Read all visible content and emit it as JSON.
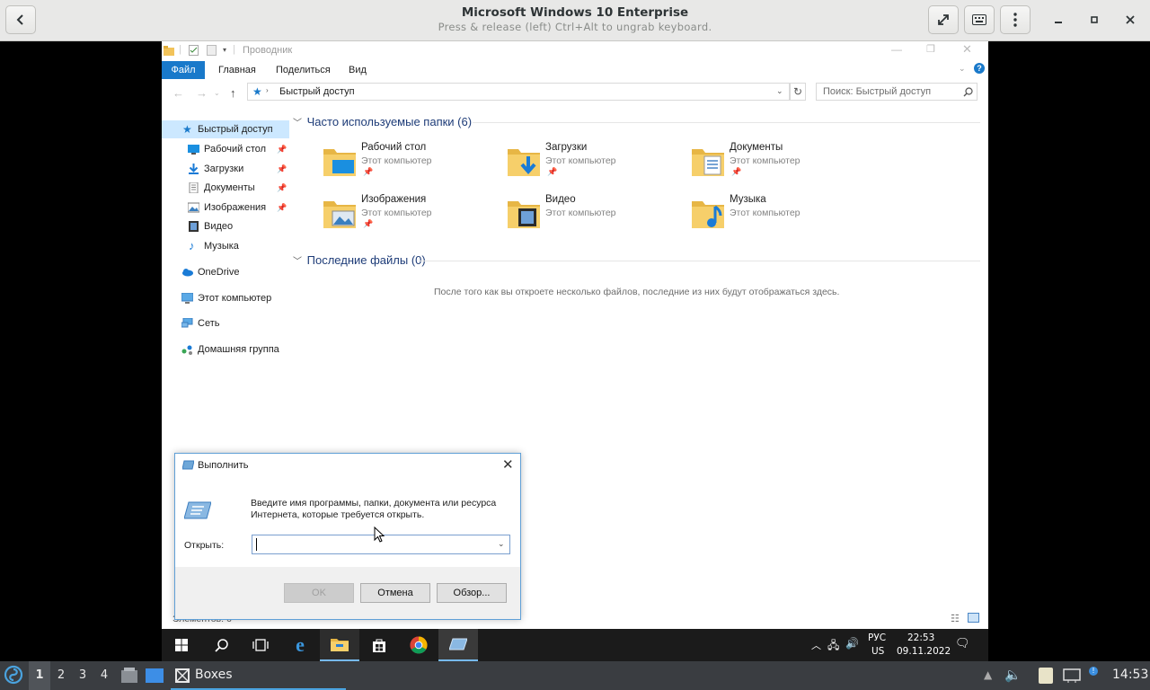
{
  "boxes": {
    "title": "Microsoft Windows 10 Enterprise",
    "subtitle": "Press & release (left) Ctrl+Alt to ungrab keyboard."
  },
  "explorer": {
    "window_title": "Проводник",
    "ribbon_tabs": [
      "Файл",
      "Главная",
      "Поделиться",
      "Вид"
    ],
    "address": "Быстрый доступ",
    "search_placeholder": "Поиск: Быстрый доступ",
    "sidebar": [
      {
        "label": "Быстрый доступ",
        "icon": "star-icon",
        "pinned": false
      },
      {
        "label": "Рабочий стол",
        "icon": "desktop-icon",
        "pinned": true
      },
      {
        "label": "Загрузки",
        "icon": "downloads-icon",
        "pinned": true
      },
      {
        "label": "Документы",
        "icon": "documents-icon",
        "pinned": true
      },
      {
        "label": "Изображения",
        "icon": "pictures-icon",
        "pinned": true
      },
      {
        "label": "Видео",
        "icon": "video-icon",
        "pinned": false
      },
      {
        "label": "Музыка",
        "icon": "music-icon",
        "pinned": false
      },
      {
        "label": "OneDrive",
        "icon": "onedrive-icon",
        "pinned": false
      },
      {
        "label": "Этот компьютер",
        "icon": "computer-icon",
        "pinned": false
      },
      {
        "label": "Сеть",
        "icon": "network-icon",
        "pinned": false
      },
      {
        "label": "Домашняя группа",
        "icon": "homegroup-icon",
        "pinned": false
      }
    ],
    "frequent_header": "Часто используемые папки (6)",
    "folders": [
      {
        "name": "Рабочий стол",
        "location": "Этот компьютер",
        "icon": "desktop-folder-icon",
        "pinned": true
      },
      {
        "name": "Загрузки",
        "location": "Этот компьютер",
        "icon": "downloads-folder-icon",
        "pinned": true
      },
      {
        "name": "Документы",
        "location": "Этот компьютер",
        "icon": "documents-folder-icon",
        "pinned": true
      },
      {
        "name": "Изображения",
        "location": "Этот компьютер",
        "icon": "pictures-folder-icon",
        "pinned": true
      },
      {
        "name": "Видео",
        "location": "Этот компьютер",
        "icon": "video-folder-icon",
        "pinned": false
      },
      {
        "name": "Музыка",
        "location": "Этот компьютер",
        "icon": "music-folder-icon",
        "pinned": false
      }
    ],
    "recent_header": "Последние файлы (0)",
    "recent_empty": "После того как вы откроете несколько файлов, последние из них будут отображаться здесь.",
    "status": "Элементов: 6"
  },
  "run_dialog": {
    "title": "Выполнить",
    "description": "Введите имя программы, папки, документа или ресурса Интернета, которые требуется открыть.",
    "open_label": "Открыть:",
    "open_value": "",
    "ok": "OK",
    "cancel": "Отмена",
    "browse": "Обзор..."
  },
  "win_taskbar": {
    "lang": "РУС",
    "layout": "US",
    "time": "22:53",
    "date": "09.11.2022"
  },
  "host_panel": {
    "workspaces": [
      "1",
      "2",
      "3",
      "4"
    ],
    "active_workspace": "1",
    "task_label": "Boxes",
    "clock": "14:53"
  },
  "colors": {
    "file_tab": "#1979ca",
    "accent_blue": "#1e3c78",
    "folder_yellow": "#f2c35a"
  }
}
